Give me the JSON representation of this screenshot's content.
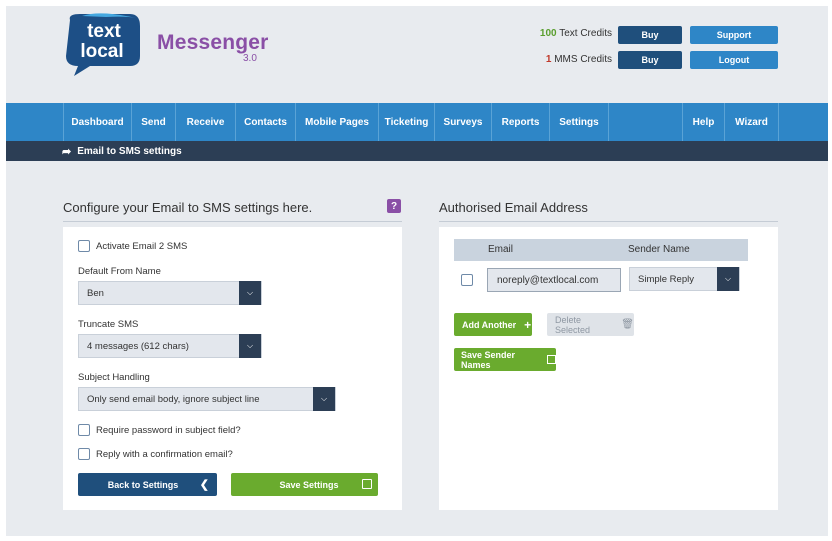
{
  "header": {
    "logo_line1": "text",
    "logo_line2": "local",
    "brand": "Messenger",
    "version": "3.0",
    "text_credits_num": "100",
    "text_credits_label": " Text Credits",
    "mms_credits_num": "1",
    "mms_credits_label": " MMS Credits",
    "buy_label": "Buy",
    "support_label": "Support",
    "logout_label": "Logout"
  },
  "nav": {
    "items": [
      "Dashboard",
      "Send",
      "Receive",
      "Contacts",
      "Mobile Pages",
      "Ticketing",
      "Surveys",
      "Reports",
      "Settings",
      "Help",
      "Wizard"
    ]
  },
  "breadcrumb": {
    "label": "Email to SMS settings"
  },
  "config": {
    "title": "Configure your Email to SMS settings here.",
    "help": "?",
    "activate_label": "Activate Email 2 SMS",
    "default_from_label": "Default From Name",
    "default_from_value": "Ben",
    "truncate_label": "Truncate SMS",
    "truncate_value": "4 messages (612 chars)",
    "subject_label": "Subject Handling",
    "subject_value": "Only send email body, ignore subject line",
    "require_pw_label": "Require password in subject field?",
    "reply_confirm_label": "Reply with a confirmation email?",
    "back_label": "Back to Settings",
    "save_label": "Save Settings"
  },
  "authorised": {
    "title": "Authorised Email Address",
    "col_email": "Email",
    "col_sender": "Sender Name",
    "row_email": "noreply@textlocal.com",
    "row_sender": "Simple Reply",
    "add_another": "Add Another",
    "delete_selected": "Delete Selected",
    "save_sender_names": "Save Sender Names"
  },
  "colors": {
    "brand_purple": "#8a4fa6",
    "nav_blue": "#2e86c7",
    "dark_navy": "#1f4f7c",
    "green": "#6aab2e"
  }
}
